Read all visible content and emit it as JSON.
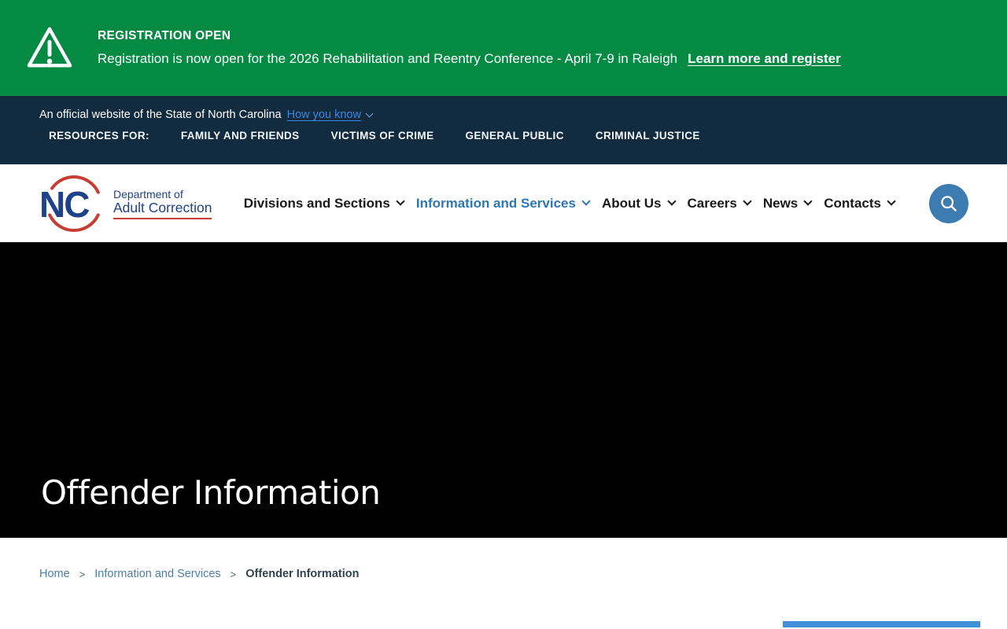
{
  "alert_banner": {
    "title": "REGISTRATION OPEN",
    "message": "Registration is now open for the 2026 Rehabilitation and Reentry Conference - April 7-9 in Raleigh",
    "link_label": "Learn more and register",
    "icon": "warning-triangle-icon"
  },
  "utility_bar": {
    "official_text": "An official website of the State of North Carolina",
    "how_you_know_label": "How you know",
    "resources_label": "RESOURCES FOR:",
    "links": [
      "FAMILY AND FRIENDS",
      "VICTIMS OF CRIME",
      "GENERAL PUBLIC",
      "CRIMINAL JUSTICE"
    ]
  },
  "header": {
    "logo": {
      "acronym": "NC",
      "line1": "Department of",
      "line2": "Adult Correction"
    },
    "nav": [
      {
        "label": "Divisions and Sections",
        "active": false
      },
      {
        "label": "Information and Services",
        "active": true
      },
      {
        "label": "About Us",
        "active": false
      },
      {
        "label": "Careers",
        "active": false
      },
      {
        "label": "News",
        "active": false
      },
      {
        "label": "Contacts",
        "active": false
      }
    ],
    "search_icon": "search-icon"
  },
  "hero": {
    "title": "Offender Information"
  },
  "breadcrumb": {
    "separator": ">",
    "items": [
      {
        "label": "Home",
        "link": true
      },
      {
        "label": "Information and Services",
        "link": true
      },
      {
        "label": "Offender Information",
        "link": false
      }
    ]
  },
  "colors": {
    "banner_green": "#048a43",
    "utility_navy": "#122b3f",
    "nav_active_blue": "#2e77b5",
    "search_button_blue": "#3d7cb0",
    "logo_blue": "#1d4289",
    "logo_red": "#c63d33",
    "breadcrumb_link_blue": "#4d7ea8",
    "card_accent_blue": "#4191d9",
    "hero_background": "#000000"
  }
}
